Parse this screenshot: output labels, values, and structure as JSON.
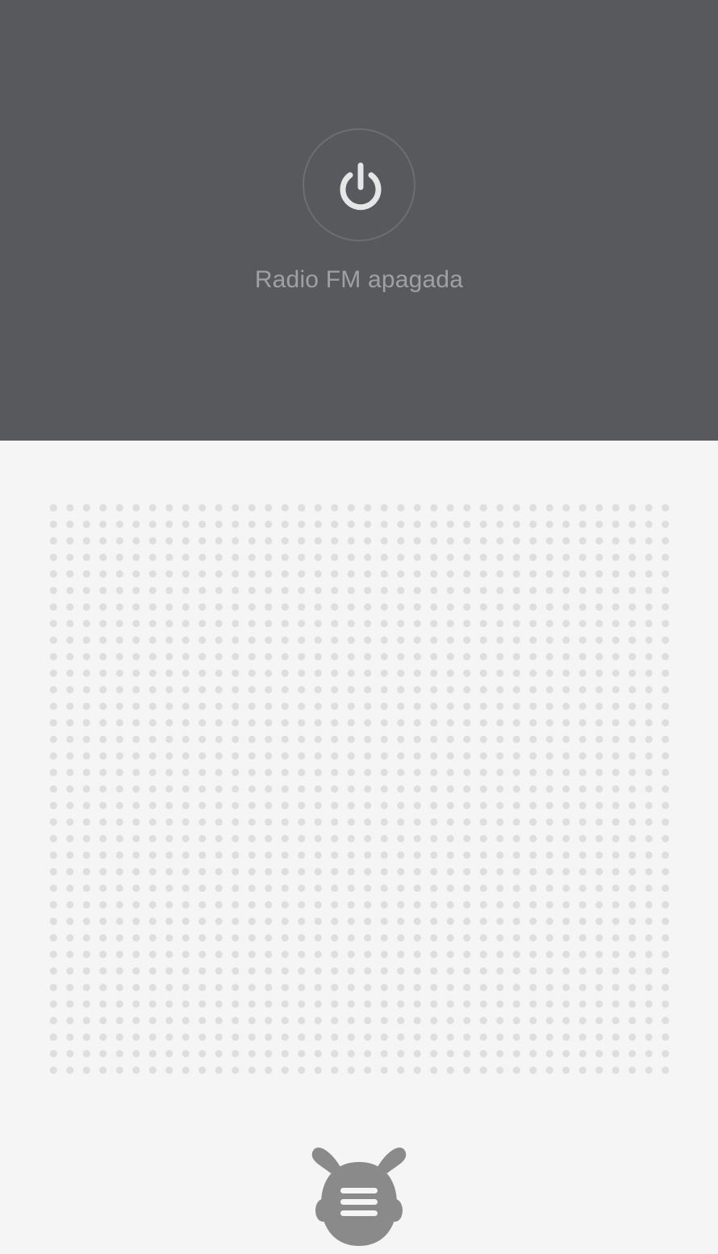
{
  "radio": {
    "status_text": "Radio FM apagada",
    "power_icon": "power-icon",
    "state": "off"
  },
  "bottom_bar": {
    "menu_icon": "mascot-menu-icon"
  },
  "colors": {
    "top_panel": "#57595d",
    "bottom_panel": "#f5f5f5",
    "status_text": "#9ea0a3",
    "power_ring": "#6c6e72",
    "power_glyph": "#e6e6e6",
    "grille_dot": "#dedede",
    "mascot": "#8a8a8a"
  }
}
